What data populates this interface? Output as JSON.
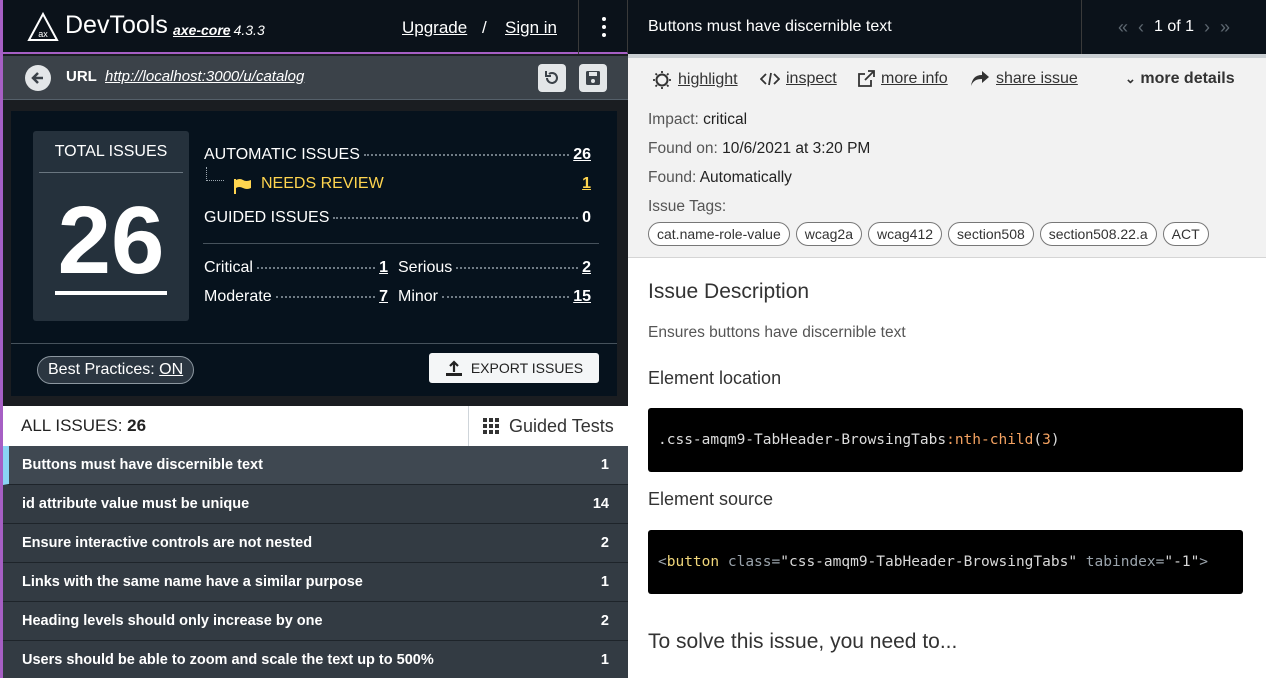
{
  "topbar": {
    "brand": "DevTools",
    "core": "axe-core",
    "version": "4.3.3",
    "upgrade": "Upgrade",
    "slash": "/",
    "signin": "Sign in"
  },
  "urlbar": {
    "label": "URL",
    "url": "http://localhost:3000/u/catalog"
  },
  "summary": {
    "total_label": "TOTAL ISSUES",
    "total": "26",
    "automatic_label": "AUTOMATIC ISSUES",
    "automatic": "26",
    "review_label": "NEEDS REVIEW",
    "review": "1",
    "guided_label": "GUIDED ISSUES",
    "guided": "0",
    "critical_label": "Critical",
    "critical": "1",
    "serious_label": "Serious",
    "serious": "2",
    "moderate_label": "Moderate",
    "moderate": "7",
    "minor_label": "Minor",
    "minor": "15",
    "best_practices_label": "Best Practices:",
    "best_practices_value": "ON",
    "export": "EXPORT ISSUES"
  },
  "tabs": {
    "all_label": "ALL ISSUES:",
    "all_count": "26",
    "guided": "Guided Tests"
  },
  "issues": [
    {
      "title": "Buttons must have discernible text",
      "count": "1"
    },
    {
      "title": "id attribute value must be unique",
      "count": "14"
    },
    {
      "title": "Ensure interactive controls are not nested",
      "count": "2"
    },
    {
      "title": "Links with the same name have a similar purpose",
      "count": "1"
    },
    {
      "title": "Heading levels should only increase by one",
      "count": "2"
    },
    {
      "title": "Users should be able to zoom and scale the text up to 500%",
      "count": "1"
    }
  ],
  "detail": {
    "title": "Buttons must have discernible text",
    "pager": "1 of 1",
    "actions": {
      "highlight": "highlight",
      "inspect": "inspect",
      "more_info": "more info",
      "share": "share issue",
      "more_details": "more details"
    },
    "impact_label": "Impact:",
    "impact": "critical",
    "found_on_label": "Found on:",
    "found_on": "10/6/2021 at 3:20 PM",
    "found_label": "Found:",
    "found": "Automatically",
    "tags_label": "Issue Tags:",
    "tags": [
      "cat.name-role-value",
      "wcag2a",
      "wcag412",
      "section508",
      "section508.22.a",
      "ACT"
    ],
    "desc_heading": "Issue Description",
    "desc": "Ensures buttons have discernible text",
    "location_heading": "Element location",
    "location_selector": ".css-amqm9-TabHeader-BrowsingTabs",
    "location_pseudo": ":nth-child",
    "location_open": "(",
    "location_num": "3",
    "location_close": ")",
    "source_heading": "Element source",
    "source_open": "<",
    "source_tag": "button",
    "source_attr1": "class",
    "source_val1": "\"css-amqm9-TabHeader-BrowsingTabs\"",
    "source_attr2": "tabindex",
    "source_val2": "\"-1\"",
    "source_close": ">",
    "solve_heading": "To solve this issue, you need to..."
  }
}
